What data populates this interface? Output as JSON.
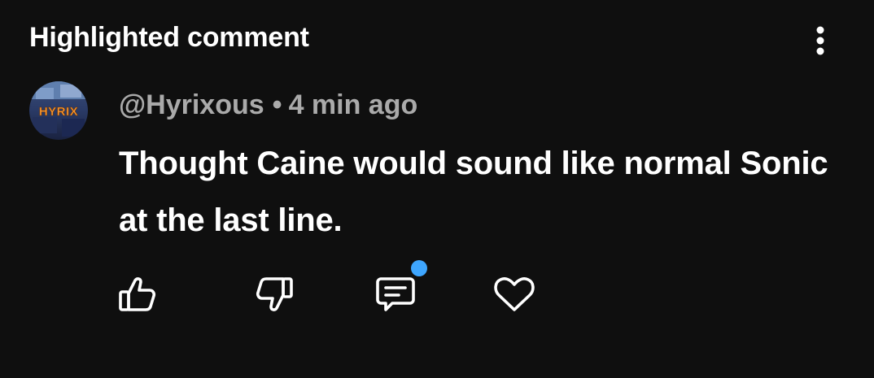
{
  "header": {
    "title": "Highlighted comment",
    "more_icon": "more-vertical-icon"
  },
  "comment": {
    "avatar_text": "HYRIX",
    "author": "@Hyrixous",
    "separator": "•",
    "timestamp": "4 min ago",
    "text": "Thought Caine would sound like normal Sonic at the last line."
  },
  "actions": {
    "like_icon": "thumbs-up-icon",
    "dislike_icon": "thumbs-down-icon",
    "reply_icon": "reply-icon",
    "heart_icon": "heart-icon",
    "reply_has_notification": true
  },
  "colors": {
    "background": "#0f0f0f",
    "text_primary": "#ffffff",
    "text_secondary": "#aaaaaa",
    "notification_dot": "#3ea6ff"
  }
}
